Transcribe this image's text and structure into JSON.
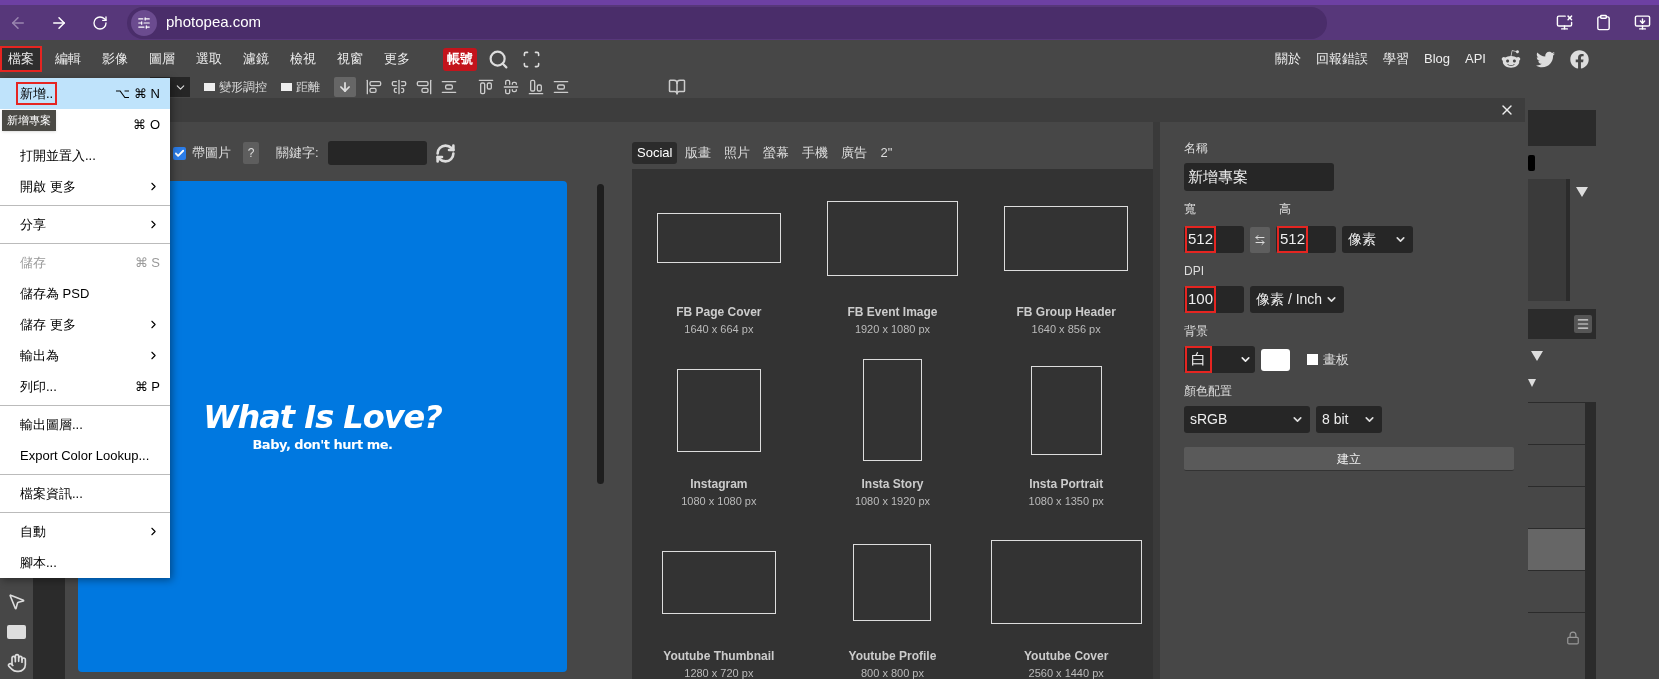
{
  "browser": {
    "url": "photopea.com"
  },
  "menubar": {
    "items": [
      {
        "label": "檔案",
        "selected": true,
        "highlighted": true
      },
      {
        "label": "編輯",
        "selected": false,
        "highlighted": false
      },
      {
        "label": "影像",
        "selected": false,
        "highlighted": false
      },
      {
        "label": "圖層",
        "selected": false,
        "highlighted": false
      },
      {
        "label": "選取",
        "selected": false,
        "highlighted": false
      },
      {
        "label": "濾鏡",
        "selected": false,
        "highlighted": false
      },
      {
        "label": "檢視",
        "selected": false,
        "highlighted": false
      },
      {
        "label": "視窗",
        "selected": false,
        "highlighted": false
      },
      {
        "label": "更多",
        "selected": false,
        "highlighted": false
      }
    ],
    "account": "帳號",
    "links": [
      "關於",
      "回報錯誤",
      "學習",
      "Blog",
      "API"
    ]
  },
  "toolbar": {
    "options": [
      {
        "label": "變形調控",
        "checked": false
      },
      {
        "label": "距離",
        "checked": false
      }
    ]
  },
  "file_menu": {
    "items": [
      {
        "kind": "item",
        "label": "新增..",
        "shortcut": "⌥ ⌘ N",
        "selected": true,
        "highlighted": true,
        "disabled": false,
        "submenu": false
      },
      {
        "kind": "item",
        "shortcut": "⌘ O",
        "selected": false,
        "highlighted": false,
        "disabled": false,
        "submenu": false
      },
      {
        "kind": "item",
        "label": "打開並置入...",
        "selected": false,
        "highlighted": false,
        "disabled": false,
        "submenu": false
      },
      {
        "kind": "item",
        "label": "開啟 更多",
        "selected": false,
        "highlighted": false,
        "disabled": false,
        "submenu": true
      },
      {
        "kind": "separator"
      },
      {
        "kind": "item",
        "label": "分享",
        "selected": false,
        "highlighted": false,
        "disabled": false,
        "submenu": true
      },
      {
        "kind": "separator"
      },
      {
        "kind": "item",
        "label": "儲存",
        "shortcut": "⌘ S",
        "selected": false,
        "highlighted": false,
        "disabled": true,
        "submenu": false
      },
      {
        "kind": "item",
        "label": "儲存為 PSD",
        "selected": false,
        "highlighted": false,
        "disabled": false,
        "submenu": false
      },
      {
        "kind": "item",
        "label": "儲存 更多",
        "selected": false,
        "highlighted": false,
        "disabled": false,
        "submenu": true
      },
      {
        "kind": "item",
        "label": "輸出為",
        "selected": false,
        "highlighted": false,
        "disabled": false,
        "submenu": true
      },
      {
        "kind": "item",
        "label": "列印...",
        "shortcut": "⌘ P",
        "selected": false,
        "highlighted": false,
        "disabled": false,
        "submenu": false
      },
      {
        "kind": "separator"
      },
      {
        "kind": "item",
        "label": "輸出圖層...",
        "selected": false,
        "highlighted": false,
        "disabled": false,
        "submenu": false
      },
      {
        "kind": "item",
        "label": "Export Color Lookup...",
        "selected": false,
        "highlighted": false,
        "disabled": false,
        "submenu": false
      },
      {
        "kind": "separator"
      },
      {
        "kind": "item",
        "label": "檔案資訊...",
        "selected": false,
        "highlighted": false,
        "disabled": false,
        "submenu": false
      },
      {
        "kind": "separator"
      },
      {
        "kind": "item",
        "label": "自動",
        "selected": false,
        "highlighted": false,
        "disabled": false,
        "submenu": true
      },
      {
        "kind": "item",
        "label": "腳本...",
        "selected": false,
        "highlighted": false,
        "disabled": false,
        "submenu": false
      }
    ]
  },
  "tooltip": "新增專案",
  "layers_panel": {
    "rows": [
      {
        "selected": false
      },
      {
        "selected": false
      },
      {
        "selected": false
      },
      {
        "selected": true
      },
      {
        "selected": false
      }
    ]
  },
  "dialog": {
    "with_images": {
      "label": "帶圖片",
      "checked": true
    },
    "help": "?",
    "keyword_label": "關鍵字:",
    "preview": {
      "title": "What Is Love?",
      "subtitle": "Baby, don't hurt me."
    },
    "tabs": [
      {
        "label": "Social",
        "selected": true
      },
      {
        "label": "版畫",
        "selected": false
      },
      {
        "label": "照片",
        "selected": false
      },
      {
        "label": "螢幕",
        "selected": false
      },
      {
        "label": "手機",
        "selected": false
      },
      {
        "label": "廣告",
        "selected": false
      },
      {
        "label": "2\"",
        "selected": false
      }
    ],
    "templates": [
      {
        "name": "FB Page Cover",
        "size": "1640 x 664 px"
      },
      {
        "name": "FB Event Image",
        "size": "1920 x 1080 px"
      },
      {
        "name": "FB Group Header",
        "size": "1640 x 856 px"
      },
      {
        "name": "Instagram",
        "size": "1080 x 1080 px"
      },
      {
        "name": "Insta Story",
        "size": "1080 x 1920 px"
      },
      {
        "name": "Insta Portrait",
        "size": "1080 x 1350 px"
      },
      {
        "name": "Youtube Thumbnail",
        "size": "1280 x 720 px"
      },
      {
        "name": "Youtube Profile",
        "size": "800 x 800 px"
      },
      {
        "name": "Youtube Cover",
        "size": "2560 x 1440 px"
      }
    ],
    "form": {
      "name_label": "名稱",
      "name": "新增專案",
      "width_label": "寬",
      "height_label": "高",
      "width": {
        "value": "512",
        "highlighted": true
      },
      "height": {
        "value": "512",
        "highlighted": true
      },
      "unit": "像素",
      "dpi_label": "DPI",
      "dpi": {
        "value": "100",
        "highlighted": true
      },
      "dpi_unit": "像素 / Inch",
      "background_label": "背景",
      "background": {
        "value": "白",
        "highlighted": true
      },
      "artboard": {
        "label": "畫板",
        "checked": false
      },
      "color_label": "顏色配置",
      "color_mode": "sRGB",
      "bit_depth": "8 bit",
      "create": "建立"
    }
  }
}
